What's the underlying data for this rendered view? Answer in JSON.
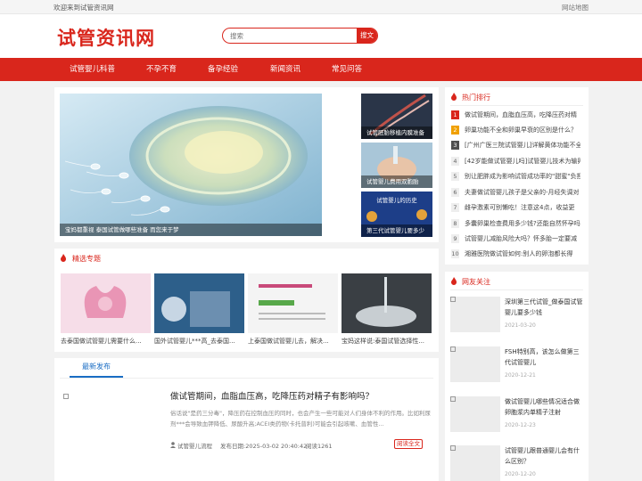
{
  "topbar": {
    "welcome": "欢迎来到试管资讯网",
    "sitemap": "网站地图"
  },
  "header": {
    "logo": "试管资讯网",
    "search_placeholder": "搜索",
    "search_button": "搜文"
  },
  "nav": [
    {
      "label": "试管婴儿科普"
    },
    {
      "label": "不孕不育"
    },
    {
      "label": "备孕经验"
    },
    {
      "label": "新闻资讯"
    },
    {
      "label": "常见问答"
    }
  ],
  "slider": {
    "main_caption": "宝妈都重视 泰国试管做哪些准备 而您来于梦",
    "side": [
      {
        "caption": "试管胚胎移植内膜准备"
      },
      {
        "caption": "试管婴儿费用双胞胎"
      },
      {
        "caption": "第三代试管婴儿要多少"
      }
    ],
    "side_3_image_text": "试管婴儿的历史"
  },
  "topic": {
    "title": "精选专题",
    "items": [
      {
        "caption": "去泰国做试管婴儿需要什么..."
      },
      {
        "caption": "国外试管婴儿***高_去泰国..."
      },
      {
        "caption": "上泰国做试管婴儿去，解决..."
      },
      {
        "caption": "宝妈这样说:泰国试管选择性..."
      }
    ]
  },
  "latest": {
    "tab": "最新发布",
    "article": {
      "title": "做试管期间，血脂血压高，吃降压药对精子有影响吗？",
      "desc": "俗话说\"是药三分毒\"，降压药在控制血压的同时，也会产生一些可能对人们身体不利的作用。比如利尿剂***会导致血钾降低、尿酸升高;ACEI类药物(卡托普利)可能会引起咳嗽、血管性...",
      "category": "试管婴儿流程",
      "date": "发布日期:2025-03-02 20:40:42",
      "views": "阅读1261",
      "read_more": "阅读全文"
    }
  },
  "hot": {
    "title": "热门排行",
    "items": [
      {
        "rank": "1",
        "text": "做试管期间，血脂血压高，吃降压药对精"
      },
      {
        "rank": "2",
        "text": "卵巢功能不全和卵巢早衰的区别是什么？"
      },
      {
        "rank": "3",
        "text": "[广州广医三院试管婴儿]详解黄体功能不全"
      },
      {
        "rank": "4",
        "text": "[42岁能做试管婴儿吗]试管婴儿技术为输卵"
      },
      {
        "rank": "5",
        "text": "别让肥胖成为影响试管成功率的\"甜蜜\"负担"
      },
      {
        "rank": "6",
        "text": "夫妻做试管婴儿孩子是父亲的-月经失调对"
      },
      {
        "rank": "7",
        "text": "雌孕激素可别懒吃！注意这4点，收益更"
      },
      {
        "rank": "8",
        "text": "多囊卵巢检查费用多少钱?还能自然怀孕吗"
      },
      {
        "rank": "9",
        "text": "试管婴儿减胎风险大吗？怀多胎一定要减"
      },
      {
        "rank": "10",
        "text": "湘雅医院做试管如何:别人的卵泡都长得"
      }
    ]
  },
  "follow": {
    "title": "网友关注",
    "items": [
      {
        "title": "深圳第三代试管_做泰国试管婴儿要多少钱",
        "date": "2021-03-20"
      },
      {
        "title": "FSH特别高，该怎么做第三代试管婴儿",
        "date": "2020-12-21"
      },
      {
        "title": "做试管婴儿哪些情况适合做卵胞浆内单精子注射",
        "date": "2020-12-23"
      },
      {
        "title": "试管婴儿跟普通婴儿会有什么区别？",
        "date": "2020-12-20"
      }
    ]
  },
  "colors": {
    "brand_red": "#d9261c",
    "tab_blue": "#1a6dc4"
  }
}
